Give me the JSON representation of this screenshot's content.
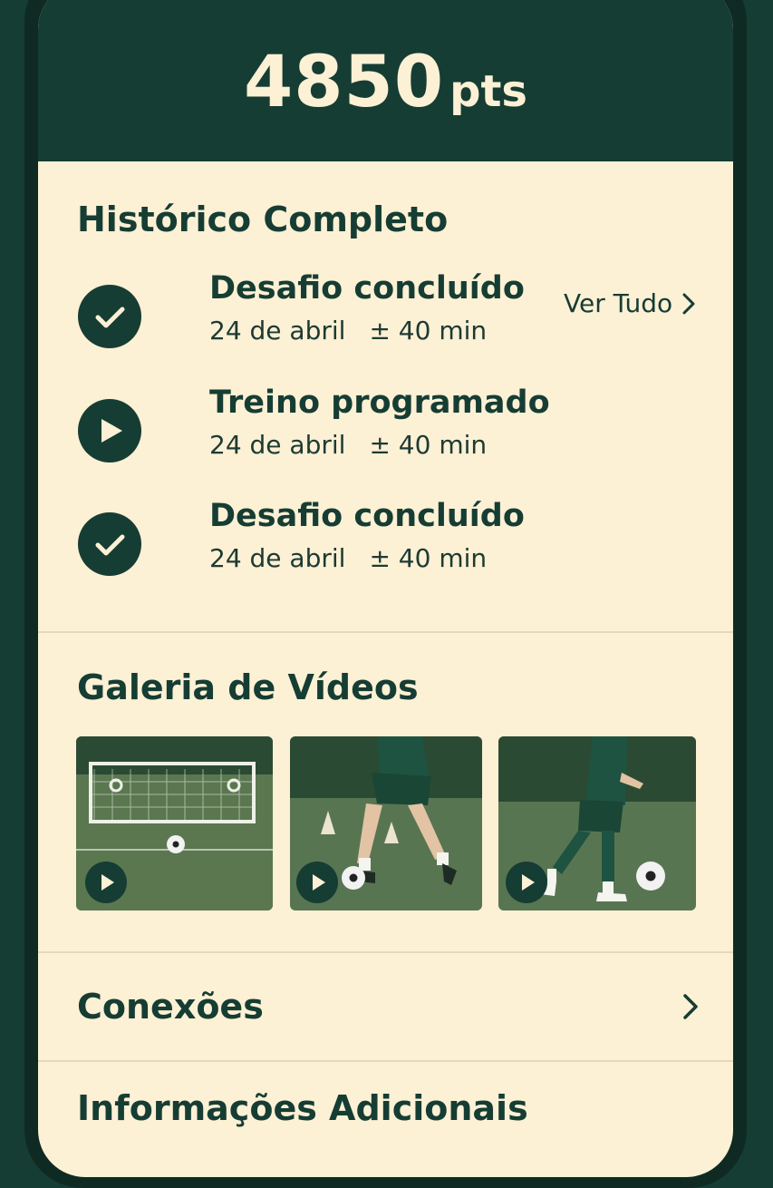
{
  "points": {
    "value": "4850",
    "unit": "pts"
  },
  "history": {
    "title": "Histórico Completo",
    "see_all_label": "Ver Tudo",
    "items": [
      {
        "icon": "check-icon",
        "title": "Desafio concluído",
        "date": "24 de abril",
        "duration": "± 40 min"
      },
      {
        "icon": "play-icon",
        "title": "Treino programado",
        "date": "24 de abril",
        "duration": "± 40 min"
      },
      {
        "icon": "check-icon",
        "title": "Desafio concluído",
        "date": "24 de abril",
        "duration": "± 40 min"
      }
    ]
  },
  "gallery": {
    "title": "Galeria de Vídeos",
    "videos": [
      {
        "icon": "play-icon"
      },
      {
        "icon": "play-icon"
      },
      {
        "icon": "play-icon"
      }
    ]
  },
  "connections": {
    "label": "Conexões",
    "icon": "chevron-right-icon"
  },
  "additional_info": {
    "label": "Informações Adicionais"
  },
  "colors": {
    "primary": "#163d33",
    "background": "#fcf0d5",
    "divider": "#e4d8bd"
  }
}
